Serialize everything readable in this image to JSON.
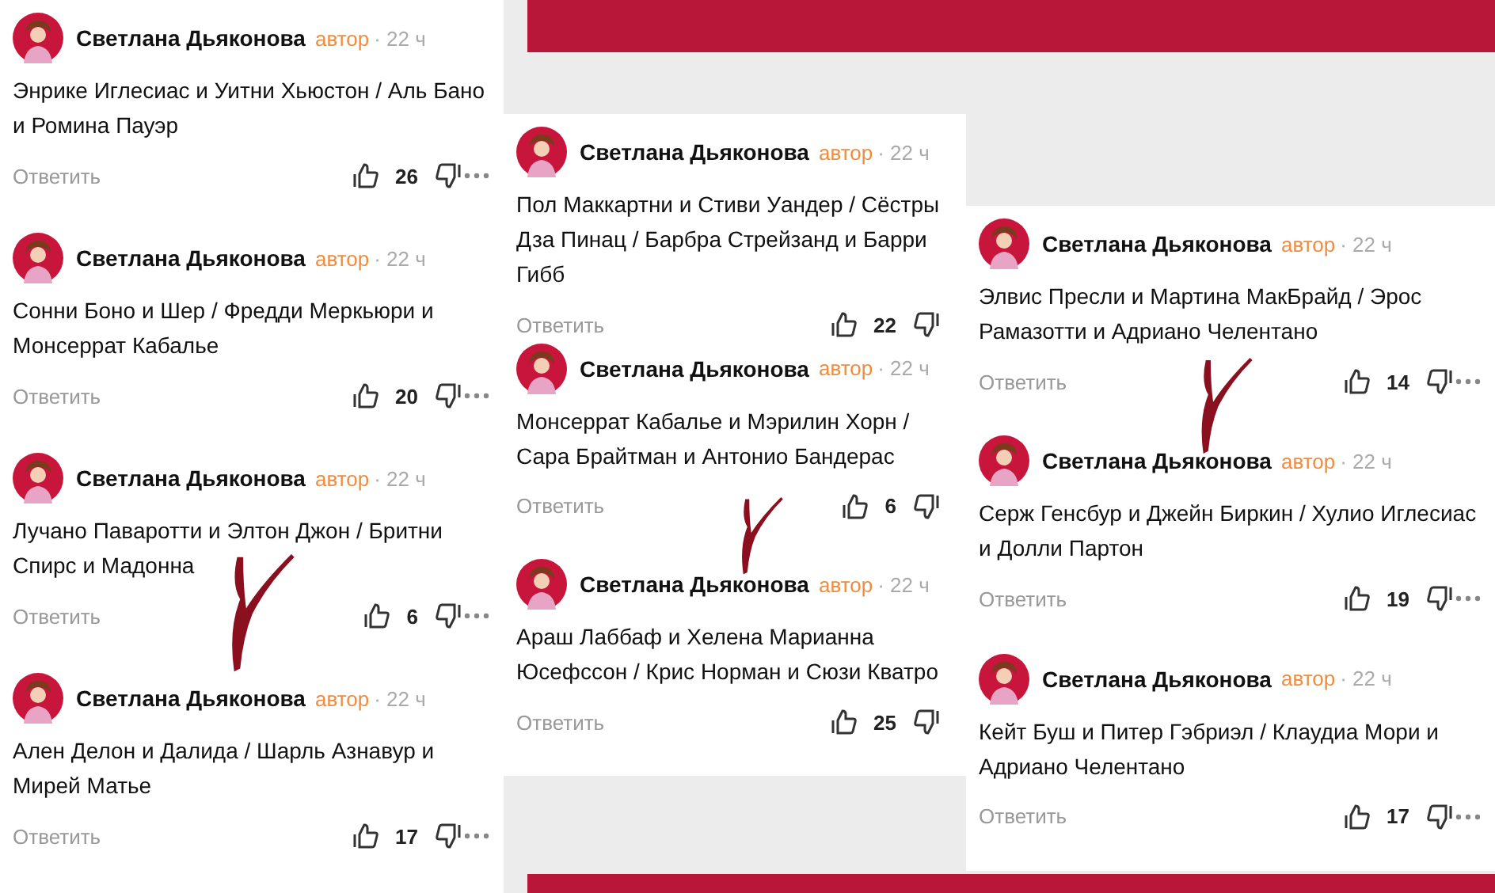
{
  "panels": [
    {
      "show_more": true,
      "comments": [
        {
          "author": "Светлана Дьяконова",
          "badge": "автор",
          "time": "· 22 ч",
          "text": "Энрике Иглесиас и Уитни Хьюстон / Аль Бано и Ромина Пауэр",
          "reply": "Ответить",
          "likes": "26"
        },
        {
          "author": "Светлана Дьяконова",
          "badge": "автор",
          "time": "· 22 ч",
          "text": "Сонни Боно и Шер / Фредди Меркьюри и Монсеррат Кабалье",
          "reply": "Ответить",
          "likes": "20"
        },
        {
          "author": "Светлана Дьяконова",
          "badge": "автор",
          "time": "· 22 ч",
          "text": "Лучано Паваротти и Элтон Джон / Бритни Спирс и Мадонна",
          "reply": "Ответить",
          "likes": "6"
        },
        {
          "author": "Светлана Дьяконова",
          "badge": "автор",
          "time": "· 22 ч",
          "text": "Ален Делон и Далида / Шарль Азнавур и Мирей Матье",
          "reply": "Ответить",
          "likes": "17"
        }
      ]
    },
    {
      "show_more": false,
      "comments": [
        {
          "author": "Светлана Дьяконова",
          "badge": "автор",
          "time": "· 22 ч",
          "text": "Пол Маккартни и Стиви Уандер / Сёстры Дза Пинац / Барбра Стрейзанд и Барри Гибб",
          "reply": "Ответить",
          "likes": "22"
        },
        {
          "author": "Светлана Дьяконова",
          "badge": "автор",
          "time": "· 22 ч",
          "text": "Монсеррат Кабалье и Мэрилин Хорн / Сара Брайтман и Антонио Бандерас",
          "reply": "Ответить",
          "likes": "6"
        },
        {
          "author": "Светлана Дьяконова",
          "badge": "автор",
          "time": "· 22 ч",
          "text": "Араш Лаббаф и Хелена Марианна Юсефссон / Крис Норман и Сюзи Кватро",
          "reply": "Ответить",
          "likes": "25"
        }
      ]
    },
    {
      "show_more": true,
      "comments": [
        {
          "author": "Светлана Дьяконова",
          "badge": "автор",
          "time": "· 22 ч",
          "text": "Элвис Пресли и Мартина МакБрайд / Эрос Рамазотти и Адриано Челентано",
          "reply": "Ответить",
          "likes": "14"
        },
        {
          "author": "Светлана Дьяконова",
          "badge": "автор",
          "time": "· 22 ч",
          "text": "Серж Генсбур и Джейн Биркин / Хулио Иглесиас и Долли Партон",
          "reply": "Ответить",
          "likes": "19"
        },
        {
          "author": "Светлана Дьяконова",
          "badge": "автор",
          "time": "· 22 ч",
          "text": "Кейт Буш и Питер Гэбриэл / Клаудиа Мори и Адриано Челентано",
          "reply": "Ответить",
          "likes": "17"
        }
      ]
    }
  ]
}
